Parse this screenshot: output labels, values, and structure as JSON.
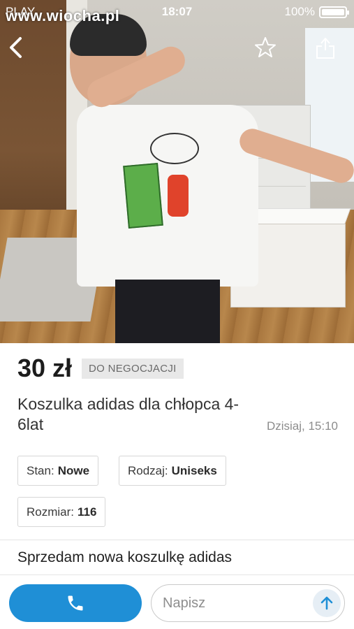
{
  "status_bar": {
    "carrier": "PLAY",
    "time": "18:07",
    "battery": "100%"
  },
  "watermark": "www.wiocha.pl",
  "icons": {
    "back": "chevron-left-icon",
    "favorite": "star-icon",
    "share": "share-icon",
    "call": "phone-icon",
    "send": "arrow-up-icon"
  },
  "listing": {
    "price": "30 zł",
    "negotiable": "DO NEGOCJACJI",
    "title": "Koszulka adidas dla chłopca 4-6lat",
    "date": "Dzisiaj, 15:10",
    "attributes": [
      {
        "label": "Stan:",
        "value": "Nowe"
      },
      {
        "label": "Rodzaj:",
        "value": "Uniseks"
      },
      {
        "label": "Rozmiar:",
        "value": "116"
      }
    ],
    "description": "Sprzedam nowa koszulkę adidas"
  },
  "message": {
    "placeholder": "Napisz"
  },
  "colors": {
    "accent": "#1f8fd6",
    "chip_border": "#d7d7d7",
    "badge_bg": "#e8e8e8"
  }
}
